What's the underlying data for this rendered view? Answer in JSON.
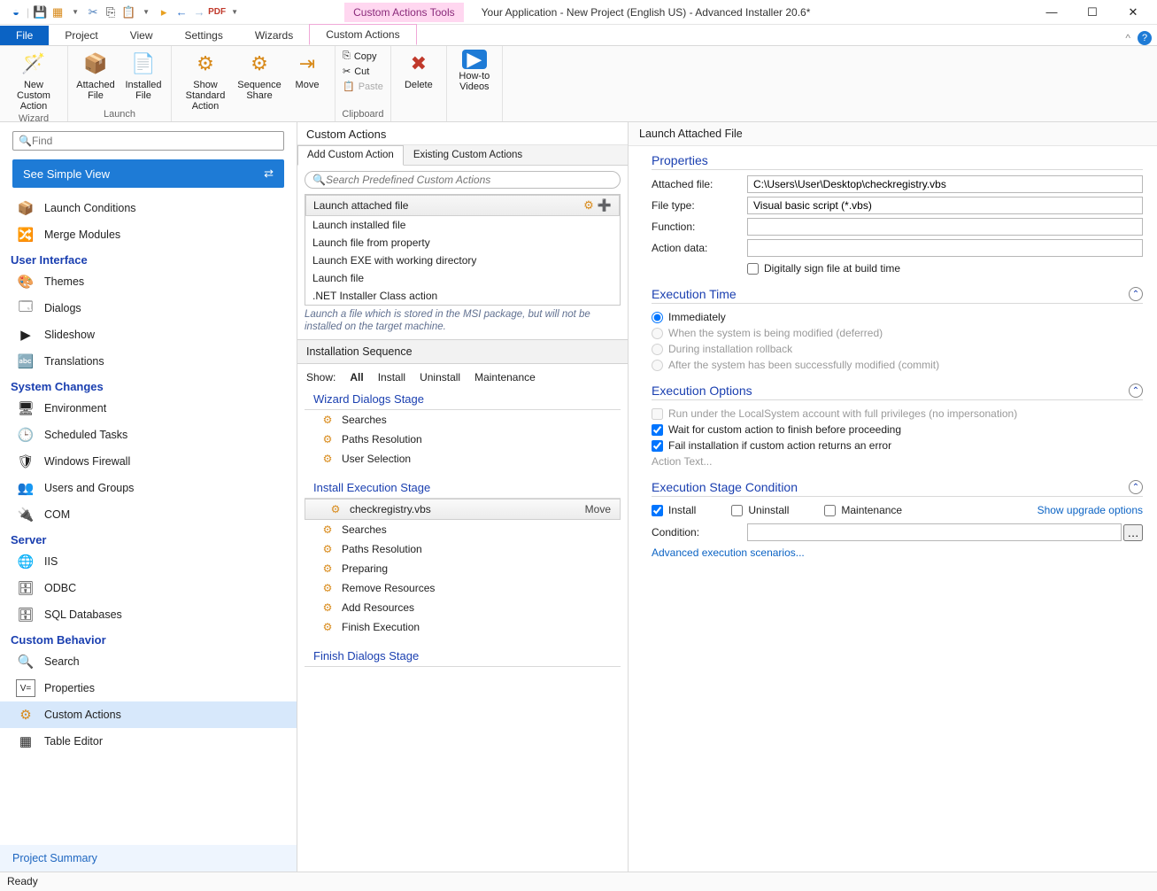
{
  "titlebar": {
    "context_tools": "Custom Actions Tools",
    "title": "Your Application - New Project (English US) - Advanced Installer 20.6*"
  },
  "menu": {
    "file": "File",
    "project": "Project",
    "view": "View",
    "settings": "Settings",
    "wizards": "Wizards",
    "custom_actions": "Custom Actions"
  },
  "ribbon": {
    "wizard_group": "Wizard",
    "launch_group": "Launch",
    "clipboard_group": "Clipboard",
    "new_custom": "New Custom Action",
    "attached": "Attached File",
    "installed": "Installed File",
    "show_std": "Show Standard Action",
    "seq_share": "Sequence Share",
    "move": "Move",
    "copy": "Copy",
    "cut": "Cut",
    "paste": "Paste",
    "delete": "Delete",
    "howto": "How-to Videos"
  },
  "leftnav": {
    "find_ph": "Find",
    "simple_view": "See Simple View",
    "items_top": [
      "Launch Conditions",
      "Merge Modules"
    ],
    "cat_ui": "User Interface",
    "ui_items": [
      "Themes",
      "Dialogs",
      "Slideshow",
      "Translations"
    ],
    "cat_sys": "System Changes",
    "sys_items": [
      "Environment",
      "Scheduled Tasks",
      "Windows Firewall",
      "Users and Groups",
      "COM"
    ],
    "cat_server": "Server",
    "server_items": [
      "IIS",
      "ODBC",
      "SQL Databases"
    ],
    "cat_behavior": "Custom Behavior",
    "behavior_items": [
      "Search",
      "Properties",
      "Custom Actions",
      "Table Editor"
    ],
    "project_summary": "Project Summary"
  },
  "middle": {
    "panel_title": "Custom Actions",
    "tab_add": "Add Custom Action",
    "tab_existing": "Existing Custom Actions",
    "search_ph": "Search Predefined Custom Actions",
    "ca_list": [
      "Launch attached file",
      "Launch installed file",
      "Launch file from property",
      "Launch EXE with working directory",
      "Launch file",
      ".NET Installer Class action"
    ],
    "ca_hint": "Launch a file which is stored in the MSI package, but will not be installed on the target machine.",
    "seq_title": "Installation Sequence",
    "show": "Show:",
    "all": "All",
    "install": "Install",
    "uninstall": "Uninstall",
    "maintenance": "Maintenance",
    "stage_wizard": "Wizard Dialogs Stage",
    "wiz_items": [
      "Searches",
      "Paths Resolution",
      "User Selection"
    ],
    "stage_install": "Install Execution Stage",
    "install_sel": "checkregistry.vbs",
    "move_label": "Move",
    "install_items": [
      "Searches",
      "Paths Resolution",
      "Preparing",
      "Remove Resources",
      "Add Resources",
      "Finish Execution"
    ],
    "stage_finish": "Finish Dialogs Stage"
  },
  "right": {
    "header": "Launch Attached File",
    "sect_props": "Properties",
    "attached_lbl": "Attached file:",
    "attached_val": "C:\\Users\\User\\Desktop\\checkregistry.vbs",
    "filetype_lbl": "File type:",
    "filetype_val": "Visual basic script (*.vbs)",
    "function_lbl": "Function:",
    "function_val": "",
    "actiondata_lbl": "Action data:",
    "actiondata_val": "",
    "sign_lbl": "Digitally sign file at build time",
    "sect_time": "Execution Time",
    "time_immediate": "Immediately",
    "time_deferred": "When the system is being modified (deferred)",
    "time_rollback": "During installation rollback",
    "time_commit": "After the system has been successfully modified (commit)",
    "sect_opts": "Execution Options",
    "opt_local": "Run under the LocalSystem account with full privileges (no impersonation)",
    "opt_wait": "Wait for custom action to finish before proceeding",
    "opt_fail": "Fail installation if custom action returns an error",
    "opt_actiontext": "Action Text...",
    "sect_cond": "Execution Stage Condition",
    "cond_install": "Install",
    "cond_uninstall": "Uninstall",
    "cond_maint": "Maintenance",
    "cond_upgrade": "Show upgrade options",
    "cond_lbl": "Condition:",
    "cond_adv": "Advanced execution scenarios..."
  },
  "status": "Ready"
}
